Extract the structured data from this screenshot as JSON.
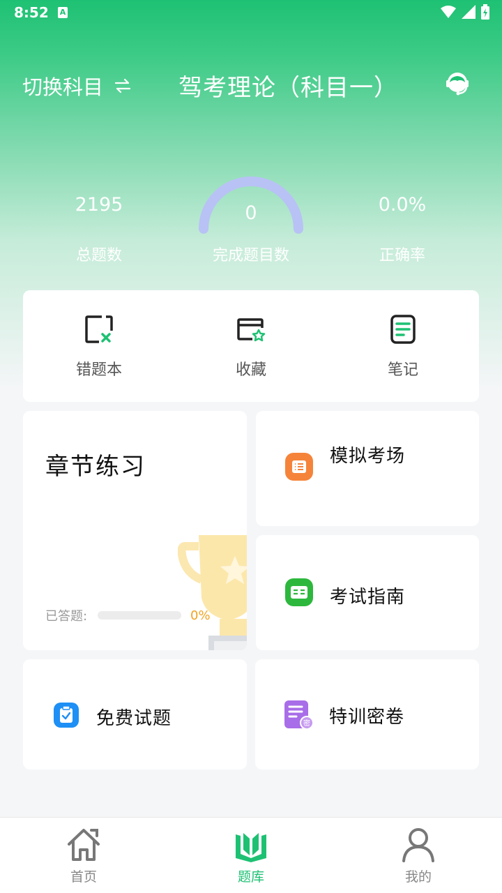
{
  "status_bar": {
    "time": "8:52",
    "notif_letter": "A"
  },
  "header": {
    "switch_label": "切换科目",
    "title": "驾考理论（科目一）"
  },
  "stats": {
    "total": {
      "value": "2195",
      "label": "总题数"
    },
    "done": {
      "value": "0",
      "label": "完成题目数"
    },
    "accuracy": {
      "value": "0.0%",
      "label": "正确率"
    }
  },
  "quick_actions": [
    {
      "label": "错题本",
      "icon": "wrong-book-icon"
    },
    {
      "label": "收藏",
      "icon": "favorite-folder-icon"
    },
    {
      "label": "笔记",
      "icon": "notes-icon"
    }
  ],
  "chapter": {
    "title": "章节练习",
    "progress_label": "已答题:",
    "progress_value": "0%",
    "progress_fraction": 0
  },
  "tiles": {
    "mock": {
      "label": "模拟考场",
      "icon": "exam-room-icon",
      "color": "#f5843a"
    },
    "guide": {
      "label": "考试指南",
      "icon": "guide-icon",
      "color": "#2db83d"
    },
    "free": {
      "label": "免费试题",
      "icon": "clipboard-icon",
      "color": "#1e8ff5"
    },
    "secret": {
      "label": "特训密卷",
      "icon": "secret-paper-icon",
      "color": "#a86de8"
    }
  },
  "bottom_nav": [
    {
      "label": "首页",
      "icon": "home-icon",
      "active": false
    },
    {
      "label": "题库",
      "icon": "question-bank-icon",
      "active": true
    },
    {
      "label": "我的",
      "icon": "profile-icon",
      "active": false
    }
  ],
  "colors": {
    "brand": "#1ec173",
    "gauge": "#b8c2f5",
    "accent": "#f2a321"
  }
}
